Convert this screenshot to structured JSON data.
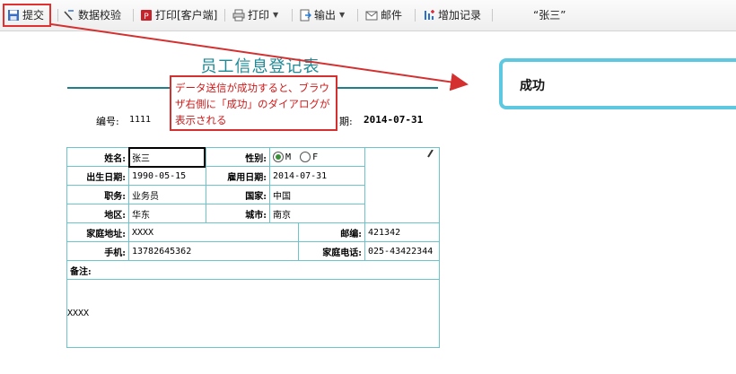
{
  "toolbar": {
    "submit": "提交",
    "validate": "数据校验",
    "print_client": "打印[客户端]",
    "print": "打印",
    "output": "输出",
    "mail": "邮件",
    "add_record": "增加记录",
    "current_name": "“张三”"
  },
  "form": {
    "title": "员工信息登记表",
    "number_label": "编号:",
    "number_value": "1111",
    "date_label": "期:",
    "date_value": "2014-07-31",
    "name_label": "姓名:",
    "name_value": "张三",
    "gender_label": "性别:",
    "gender_m": "M",
    "gender_f": "F",
    "gender_selected": "M",
    "birth_label": "出生日期:",
    "birth_value": "1990-05-15",
    "hire_label": "雇用日期:",
    "hire_value": "2014-07-31",
    "position_label": "职务:",
    "position_value": "业务员",
    "country_label": "国家:",
    "country_value": "中国",
    "region_label": "地区:",
    "region_value": "华东",
    "city_label": "城市:",
    "city_value": "南京",
    "address_label": "家庭地址:",
    "address_value": "XXXX",
    "zip_label": "邮编:",
    "zip_value": "421342",
    "mobile_label": "手机:",
    "mobile_value": "13782645362",
    "home_phone_label": "家庭电话:",
    "home_phone_value": "025-43422344",
    "remarks_label": "备注:",
    "remarks_value": "XXXX"
  },
  "callout": {
    "text": "データ送信が成功すると、ブラウザ右側に「成功」のダイアログが表示される"
  },
  "dialog": {
    "message": "成功"
  },
  "colors": {
    "accent": "#1f8a96",
    "table_border": "#6cc4cc",
    "annotation_red": "#d43030",
    "dialog_border": "#5dc8e0"
  }
}
